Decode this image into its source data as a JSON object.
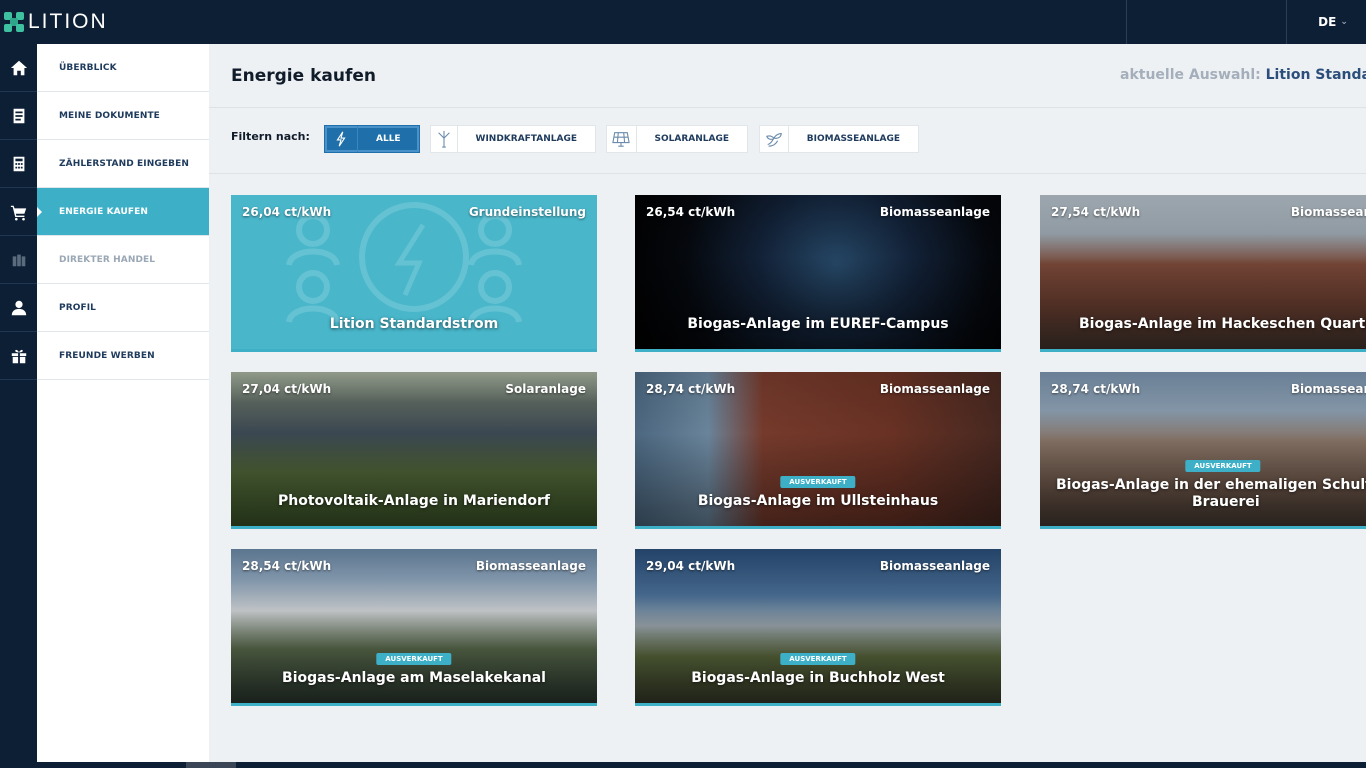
{
  "app": {
    "logo_text": "LITION",
    "language": "DE"
  },
  "rail": {
    "icons": [
      "home-icon",
      "document-icon",
      "calculator-icon",
      "cart-icon",
      "trade-icon",
      "user-icon",
      "gift-icon"
    ]
  },
  "sidebar": {
    "items": [
      {
        "label": "ÜBERBLICK"
      },
      {
        "label": "MEINE DOKUMENTE"
      },
      {
        "label": "ZÄHLERSTAND EINGEBEN"
      },
      {
        "label": "ENERGIE KAUFEN"
      },
      {
        "label": "DIREKTER HANDEL"
      },
      {
        "label": "PROFIL"
      },
      {
        "label": "FREUNDE WERBEN"
      }
    ]
  },
  "header": {
    "title": "Energie kaufen",
    "selection_label": "aktuelle Auswahl:",
    "selection_value": "Lition Standards"
  },
  "filter": {
    "label": "Filtern nach:",
    "chips": [
      {
        "label": "ALLE",
        "icon": "lightning-icon"
      },
      {
        "label": "WINDKRAFTANLAGE",
        "icon": "wind-turbine-icon"
      },
      {
        "label": "SOLARANLAGE",
        "icon": "solar-panel-icon"
      },
      {
        "label": "BIOMASSEANLAGE",
        "icon": "biomass-icon"
      }
    ]
  },
  "cards": [
    {
      "price": "26,04 ct/kWh",
      "type": "Grundeinstellung",
      "name": "Lition Standardstrom",
      "badge": ""
    },
    {
      "price": "26,54 ct/kWh",
      "type": "Biomasseanlage",
      "name": "Biogas-Anlage im EUREF-Campus",
      "badge": ""
    },
    {
      "price": "27,54 ct/kWh",
      "type": "Biomassean",
      "name": "Biogas-Anlage im Hackeschen Quartier",
      "badge": ""
    },
    {
      "price": "27,04 ct/kWh",
      "type": "Solaranlage",
      "name": "Photovoltaik-Anlage in Mariendorf",
      "badge": ""
    },
    {
      "price": "28,74 ct/kWh",
      "type": "Biomasseanlage",
      "name": "Biogas-Anlage im Ullsteinhaus",
      "badge": "AUSVERKAUFT"
    },
    {
      "price": "28,74 ct/kWh",
      "type": "Biomassean",
      "name": "Biogas-Anlage in der ehemaligen Schulthei",
      "name2": "Brauerei",
      "badge": "AUSVERKAUFT"
    },
    {
      "price": "28,54 ct/kWh",
      "type": "Biomasseanlage",
      "name": "Biogas-Anlage am Maselakekanal",
      "badge": "AUSVERKAUFT"
    },
    {
      "price": "29,04 ct/kWh",
      "type": "Biomasseanlage",
      "name": "Biogas-Anlage in Buchholz West",
      "badge": "AUSVERKAUFT"
    }
  ],
  "colors": {
    "accent": "#3db0c7",
    "dark": "#0d1f35",
    "filter_active": "#1f6faa"
  }
}
